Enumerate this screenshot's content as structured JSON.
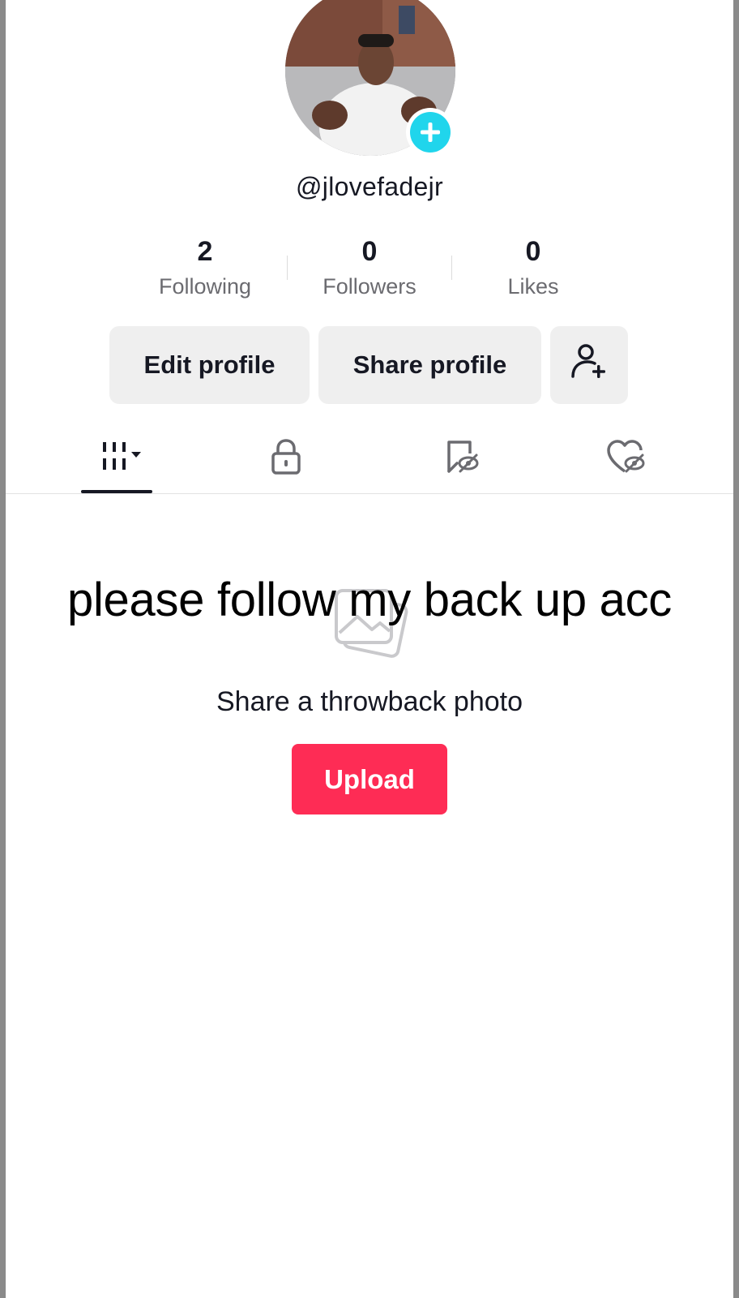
{
  "profile": {
    "username": "@jlovefadejr"
  },
  "stats": [
    {
      "value": "2",
      "label": "Following"
    },
    {
      "value": "0",
      "label": "Followers"
    },
    {
      "value": "0",
      "label": "Likes"
    }
  ],
  "actions": {
    "edit_label": "Edit profile",
    "share_label": "Share profile"
  },
  "tabs": [
    {
      "icon": "videos-grid-icon",
      "selected": true
    },
    {
      "icon": "lock-icon",
      "selected": false
    },
    {
      "icon": "favorites-hidden-icon",
      "selected": false
    },
    {
      "icon": "liked-hidden-icon",
      "selected": false
    }
  ],
  "overlay_caption": "please follow my back up acc",
  "empty_state": {
    "icon": "photos-icon",
    "text": "Share a throwback photo",
    "upload_label": "Upload"
  },
  "colors": {
    "accent": "#fe2c55",
    "add_badge": "#20d5ec",
    "text": "#161823",
    "button_bg": "#efefef"
  }
}
